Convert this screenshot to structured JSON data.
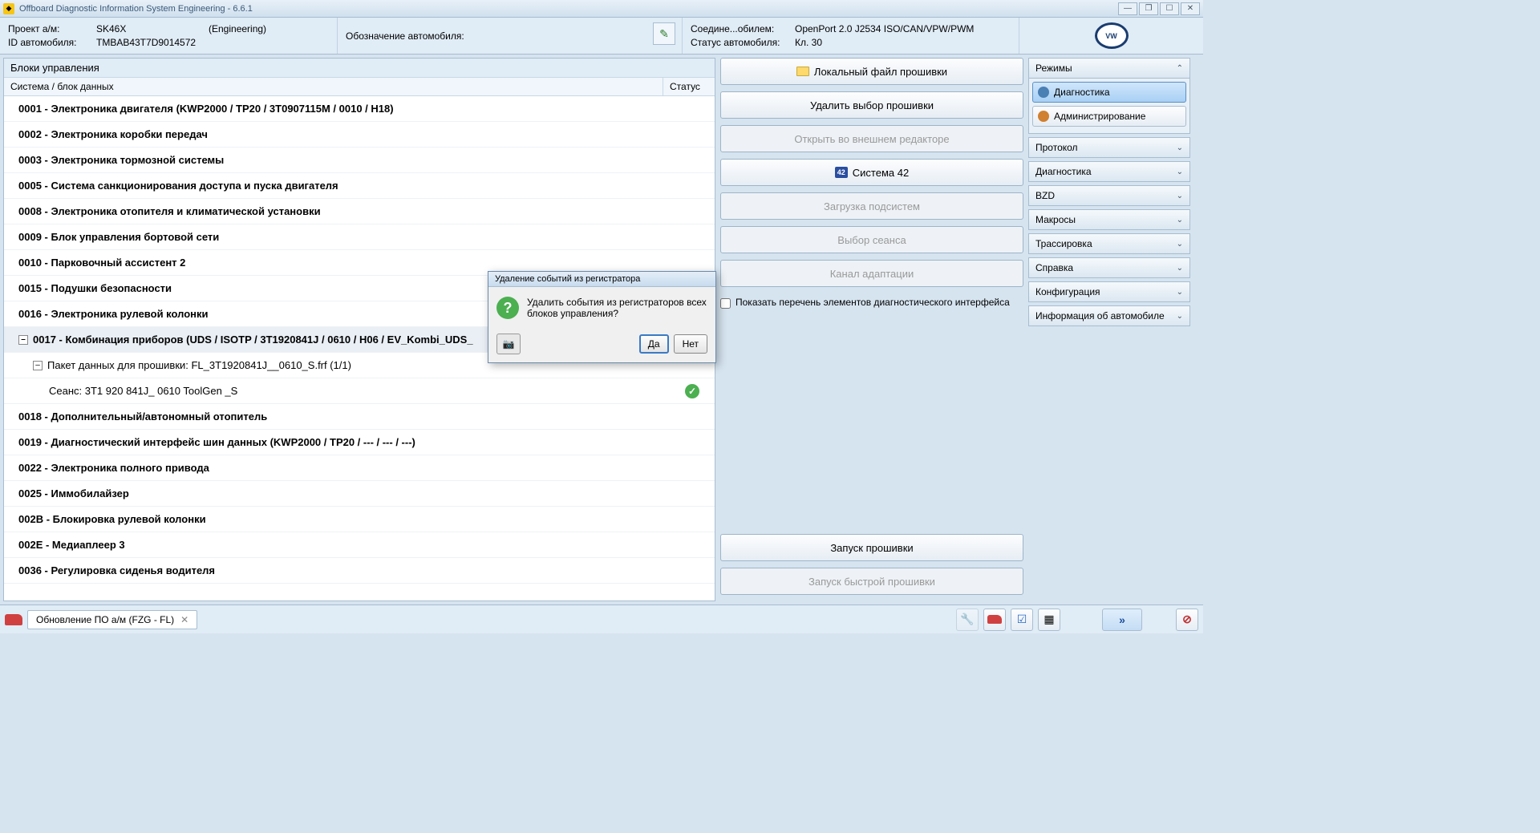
{
  "window": {
    "title": "Offboard Diagnostic Information System Engineering - 6.6.1",
    "min": "—",
    "restore": "❐",
    "max": "☐",
    "close": "✕"
  },
  "header": {
    "proj_label": "Проект а/м:",
    "proj_val": "SK46X",
    "eng": "(Engineering)",
    "vin_label": "ID автомобиля:",
    "vin_val": "TMBAB43T7D9014572",
    "designation_label": "Обозначение автомобиля:",
    "conn_label": "Соедине...обилем:",
    "conn_val": "OpenPort 2.0 J2534 ISO/CAN/VPW/PWM",
    "status_label": "Статус автомобиля:",
    "status_val": "Кл. 30"
  },
  "left": {
    "title": "Блоки управления",
    "col_system": "Система / блок данных",
    "col_status": "Статус",
    "rows": [
      {
        "t": "0001 - Электроника двигателя  (KWP2000 / TP20 / 3T0907115M / 0010 / H18)"
      },
      {
        "t": "0002 - Электроника коробки передач"
      },
      {
        "t": "0003 - Электроника тормозной системы"
      },
      {
        "t": "0005 - Система санкционирования доступа и пуска двигателя"
      },
      {
        "t": "0008 - Электроника отопителя и климатической установки"
      },
      {
        "t": "0009 - Блок управления бортовой сети"
      },
      {
        "t": "0010 - Парковочный ассистент 2"
      },
      {
        "t": "0015 - Подушки безопасности"
      },
      {
        "t": "0016 - Электроника рулевой колонки"
      },
      {
        "t": "0017 - Комбинация приборов  (UDS / ISOTP / 3T1920841J / 0610 / H06 / EV_Kombi_UDS_"
      },
      {
        "t": "Пакет данных для прошивки: FL_3T1920841J__0610_S.frf (1/1)"
      },
      {
        "t": "Сеанс: 3T1 920 841J_ 0610 ToolGen _S"
      },
      {
        "t": "0018 - Дополнительный/автономный отопитель"
      },
      {
        "t": "0019 - Диагностический интерфейс шин данных  (KWP2000 / TP20 / --- / --- / ---)"
      },
      {
        "t": "0022 - Электроника полного привода"
      },
      {
        "t": "0025 - Иммобилайзер"
      },
      {
        "t": "002B - Блокировка рулевой колонки"
      },
      {
        "t": "002E - Медиаплеер 3"
      },
      {
        "t": "0036 - Регулировка сиденья водителя"
      }
    ]
  },
  "mid": {
    "btn_local": "Локальный файл прошивки",
    "btn_delete": "Удалить выбор прошивки",
    "btn_external": "Открыть во внешнем редакторе",
    "btn_s42": "Система 42",
    "btn_subsys": "Загрузка подсистем",
    "btn_session": "Выбор сеанса",
    "btn_adapt": "Канал адаптации",
    "check_label": "Показать перечень элементов диагностического интерфейса",
    "btn_flash": "Запуск прошивки",
    "btn_fastflash": "Запуск быстрой прошивки"
  },
  "right": {
    "modes_title": "Режимы",
    "mode_diag": "Диагностика",
    "mode_admin": "Администрирование",
    "sections": [
      "Протокол",
      "Диагностика",
      "BZD",
      "Макросы",
      "Трассировка",
      "Справка",
      "Конфигурация",
      "Информация об автомобиле"
    ]
  },
  "bottom": {
    "tab": "Обновление ПО а/м (FZG - FL)"
  },
  "dialog": {
    "title": "Удаление событий из регистратора",
    "text": "Удалить события из регистраторов всех блоков управления?",
    "yes": "Да",
    "no": "Нет"
  }
}
